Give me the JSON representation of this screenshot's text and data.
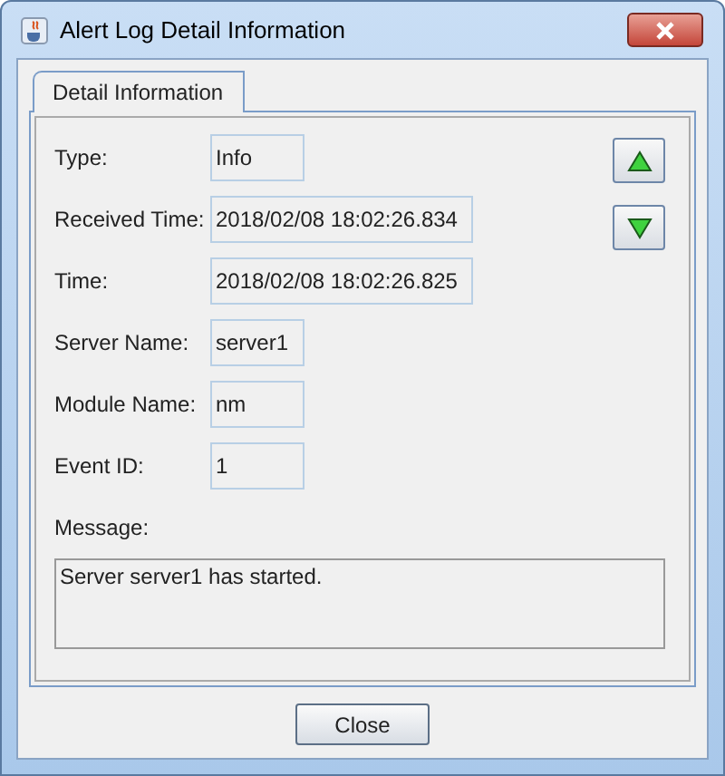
{
  "window": {
    "title": "Alert Log Detail Information"
  },
  "tabs": [
    {
      "label": "Detail Information",
      "selected": true
    }
  ],
  "fields": [
    {
      "label": "Type:",
      "value": "Info"
    },
    {
      "label": "Received Time:",
      "value": "2018/02/08 18:02:26.834"
    },
    {
      "label": "Time:",
      "value": "2018/02/08 18:02:26.825"
    },
    {
      "label": "Server Name:",
      "value": "server1"
    },
    {
      "label": "Module Name:",
      "value": "nm"
    },
    {
      "label": "Event ID:",
      "value": "1"
    }
  ],
  "message": {
    "label": "Message:",
    "value": "Server server1 has started."
  },
  "buttons": [
    "Close"
  ]
}
